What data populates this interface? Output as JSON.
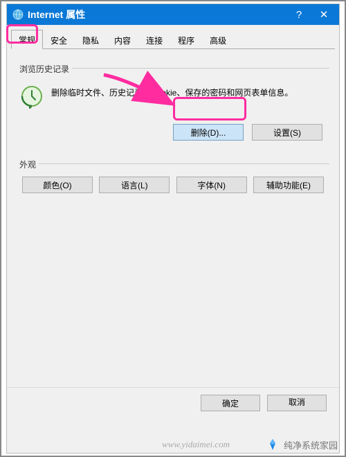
{
  "window": {
    "title": "Internet 属性",
    "help": "?",
    "close": "✕"
  },
  "tabs": {
    "items": [
      {
        "label": "常规",
        "active": true
      },
      {
        "label": "安全"
      },
      {
        "label": "隐私"
      },
      {
        "label": "内容"
      },
      {
        "label": "连接"
      },
      {
        "label": "程序"
      },
      {
        "label": "高级"
      }
    ]
  },
  "history": {
    "group_label": "浏览历史记录",
    "description": "删除临时文件、历史记录、Cookie、保存的密码和网页表单信息。",
    "delete_label": "删除(D)...",
    "settings_label": "设置(S)"
  },
  "appearance": {
    "group_label": "外观",
    "color_label": "颜色(O)",
    "language_label": "语言(L)",
    "font_label": "字体(N)",
    "accessibility_label": "辅助功能(E)"
  },
  "footer": {
    "ok_label": "确定",
    "cancel_label": "取消"
  },
  "watermark": {
    "text": "纯净系统家园",
    "url": "www.yidaimei.com"
  }
}
